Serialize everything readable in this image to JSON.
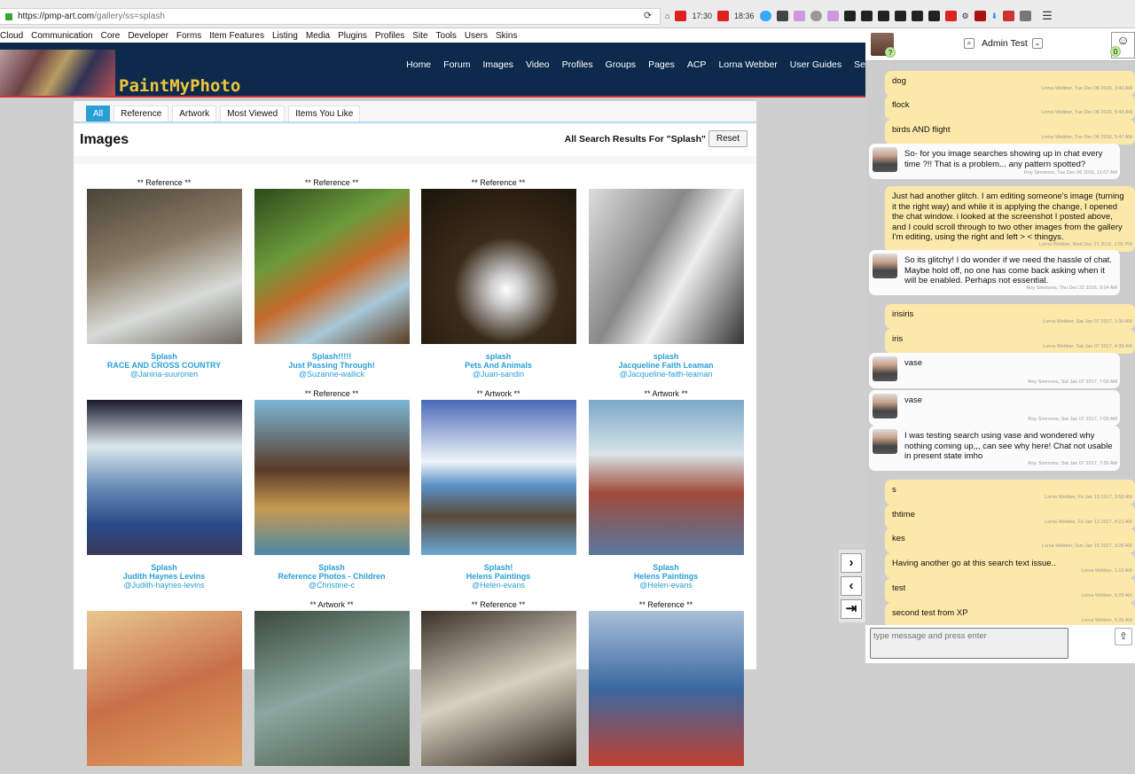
{
  "browser": {
    "url_host": "https://pmp-art.com",
    "url_path": "/gallery/ss=splash",
    "yt1": "17:30",
    "yt2": "18:36",
    "reload": "⟳",
    "menu": "☰"
  },
  "menubar": [
    "Cloud",
    "Communication",
    "Core",
    "Developer",
    "Forms",
    "Item Features",
    "Listing",
    "Media",
    "Plugins",
    "Profiles",
    "Site",
    "Tools",
    "Users",
    "Skins"
  ],
  "site": {
    "logo": "PaintMyPhoto",
    "nav": [
      "Home",
      "Forum",
      "Images",
      "Video",
      "Profiles",
      "Groups",
      "Pages",
      "ACP",
      "Lorna Webber",
      "User Guides",
      "Se"
    ]
  },
  "tabs": [
    "All",
    "Reference",
    "Artwork",
    "Most Viewed",
    "Items You Like"
  ],
  "page": {
    "title": "Images",
    "results": "All Search Results For \"Splash\"",
    "reset": "Reset"
  },
  "gallery": [
    {
      "type": "** Reference **",
      "title": "Splash",
      "album": "RACE AND CROSS COUNTRY",
      "user": "@Janina-suuronen"
    },
    {
      "type": "** Reference **",
      "title": "Splash!!!!!",
      "album": "Just Passing Through!",
      "user": "@Suzanne-wallick"
    },
    {
      "type": "** Reference **",
      "title": "splash",
      "album": "Pets And Animals",
      "user": "@Juan-sandin"
    },
    {
      "type": "",
      "title": "splash",
      "album": "Jacqueline Faith Leaman",
      "user": "@Jacqueline-faith-leaman"
    },
    {
      "type": "",
      "title": "Splash",
      "album": "Judith Haynes Levins",
      "user": "@Judith-haynes-levins"
    },
    {
      "type": "** Reference **",
      "title": "Splash",
      "album": "Reference Photos - Children",
      "user": "@Christine-c"
    },
    {
      "type": "** Artwork **",
      "title": "Splash!",
      "album": "Helens Paintings",
      "user": "@Helen-evans"
    },
    {
      "type": "** Artwork **",
      "title": "Splash",
      "album": "Helens Paintings",
      "user": "@Helen-evans"
    },
    {
      "type": "",
      "title": "",
      "album": "",
      "user": ""
    },
    {
      "type": "** Artwork **",
      "title": "",
      "album": "",
      "user": ""
    },
    {
      "type": "** Reference **",
      "title": "",
      "album": "",
      "user": ""
    },
    {
      "type": "** Reference **",
      "title": "",
      "album": "",
      "user": ""
    }
  ],
  "chat": {
    "user": "Admin Test",
    "my_badge": "?",
    "user_badge": "0",
    "placeholder": "type message and press enter",
    "send": "⇧",
    "messages": [
      {
        "from": "me",
        "text": "dog",
        "ts": "Lorna Webber, Tue Dec 06 2016, 3:40 AM"
      },
      {
        "from": "me",
        "text": "flock",
        "ts": "Lorna Webber, Tue Dec 06 2016, 5:43 AM"
      },
      {
        "from": "me",
        "text": "birds AND flight",
        "ts": "Lorna Webber, Tue Dec 06 2016, 5:47 AM"
      },
      {
        "from": "them",
        "text": "So- for you image searches showing up in chat every time ?!! That is a problem... any pattern spotted?",
        "ts": "Roy Simmons, Tue Dec 06 2016, 11:07 AM"
      },
      {
        "from": "me",
        "text": "Just had another glitch. I am editing someone's image (turning it the right way) and while it is applying the change, I opened the chat window. i looked at the screenshot I posted above, and I could scroll through to two other images from the gallery I'm editing, using the right and left > < thingys.",
        "ts": "Lorna Webber, Wed Dec 21 2016, 1:55 PM"
      },
      {
        "from": "them",
        "text": "So its glitchy! I do wonder if we need the hassle of chat. Maybe hold off, no one has come back asking when it will be enabled. Perhaps not essential.",
        "ts": "Roy Simmons, Thu Dec 22 2016, 9:24 AM"
      },
      {
        "from": "me",
        "text": "irisiris",
        "ts": "Lorna Webber, Sat Jan 07 2017, 1:30 AM"
      },
      {
        "from": "me",
        "text": "iris",
        "ts": "Lorna Webber, Sat Jan 07 2017, 4:38 AM"
      },
      {
        "from": "them",
        "text": "vase",
        "ts": "Roy Simmons, Sat Jan 07 2017, 7:09 AM"
      },
      {
        "from": "them",
        "text": "vase",
        "ts": "Roy Simmons, Sat Jan 07 2017, 7:09 AM"
      },
      {
        "from": "them",
        "text": "I was testing search using vase and wondered why nothing coming up,,, can see why here! Chat not usable in present state imho",
        "ts": "Roy Simmons, Sat Jan 07 2017, 7:36 AM"
      },
      {
        "from": "me",
        "text": "s",
        "ts": "Lorna Webber, Fri Jan 13 2017, 3:58 AM"
      },
      {
        "from": "me",
        "text": "thtime",
        "ts": "Lorna Webber, Fri Jan 13 2017, 4:21 AM"
      },
      {
        "from": "me",
        "text": "kes",
        "ts": "Lorna Webber, Sun Jan 15 2017, 3:28 AM"
      },
      {
        "from": "me",
        "text": "Having another go at this search text issue..",
        "ts": "Lorna Webber, 1:10 AM"
      },
      {
        "from": "me",
        "text": "test",
        "ts": "Lorna Webber, 6:29 AM"
      },
      {
        "from": "me",
        "text": "second test from XP",
        "ts": "Lorna Webber, 6:36 AM"
      }
    ]
  },
  "viewer_nav": {
    "next": "›",
    "prev": "‹",
    "last": "⇥"
  }
}
